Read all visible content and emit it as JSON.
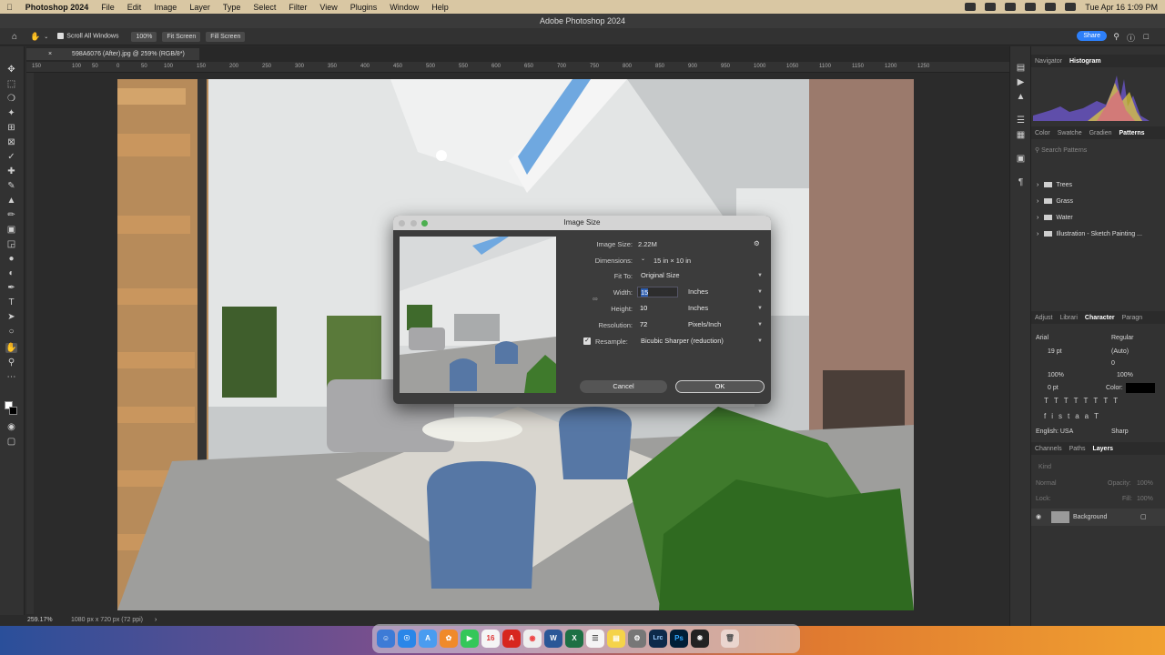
{
  "menubar": {
    "app": "Photoshop 2024",
    "items": [
      "File",
      "Edit",
      "Image",
      "Layer",
      "Type",
      "Select",
      "Filter",
      "View",
      "Plugins",
      "Window",
      "Help"
    ],
    "clock": "Tue Apr 16  1:09 PM"
  },
  "window": {
    "title": "Adobe Photoshop 2024"
  },
  "options_bar": {
    "scroll_all": "Scroll All Windows",
    "zoom_100": "100%",
    "fit_screen": "Fit Screen",
    "fill_screen": "Fill Screen",
    "share": "Share"
  },
  "document": {
    "tab": "598A6076 (After).jpg @ 259% (RGB/8*)"
  },
  "status": {
    "zoom": "259.17%",
    "dims": "1080 px x 720 px (72 ppi)"
  },
  "ruler_labels": [
    "150",
    "100",
    "50",
    "0",
    "50",
    "100",
    "150",
    "200",
    "250",
    "300",
    "350",
    "400",
    "450",
    "500",
    "550",
    "600",
    "650",
    "700",
    "750",
    "800",
    "850",
    "900",
    "950",
    "1000",
    "1050",
    "1100",
    "1150",
    "1200",
    "1250"
  ],
  "right_panel": {
    "top_tabs": [
      "Navigator",
      "Histogram"
    ],
    "mid_tabs": [
      "Color",
      "Swatche",
      "Gradien",
      "Patterns"
    ],
    "search_placeholder": "Search Patterns",
    "patterns": [
      "Trees",
      "Grass",
      "Water",
      "Illustration - Sketch Painting ..."
    ],
    "char_tabs": [
      "Adjust",
      "Librari",
      "Character",
      "Paragn"
    ],
    "font": "Arial",
    "style": "Regular",
    "size": "19 pt",
    "leading": "(Auto)",
    "tracking": "0",
    "vscale": "100%",
    "hscale": "100%",
    "baseline": "0 pt",
    "color_label": "Color:",
    "language": "English: USA",
    "aa": "Sharp",
    "layer_tabs": [
      "Channels",
      "Paths",
      "Layers"
    ],
    "layer_kind": "Kind",
    "blend": "Normal",
    "opacity": "Opacity:",
    "opacity_val": "100%",
    "lock": "Lock:",
    "fill": "Fill:",
    "fill_val": "100%",
    "layer_name": "Background"
  },
  "dialog": {
    "title": "Image Size",
    "image_size_label": "Image Size:",
    "image_size": "2.22M",
    "dimensions_label": "Dimensions:",
    "dimensions": "15 in  ×  10 in",
    "fit_to_label": "Fit To:",
    "fit_to": "Original Size",
    "width_label": "Width:",
    "width": "15",
    "width_unit": "Inches",
    "height_label": "Height:",
    "height": "10",
    "height_unit": "Inches",
    "resolution_label": "Resolution:",
    "resolution": "72",
    "resolution_unit": "Pixels/Inch",
    "resample_label": "Resample:",
    "resample": "Bicubic Sharper (reduction)",
    "cancel": "Cancel",
    "ok": "OK"
  },
  "dock": {
    "calendar_day": "16",
    "lrc": "Lrc",
    "ps": "Ps"
  }
}
